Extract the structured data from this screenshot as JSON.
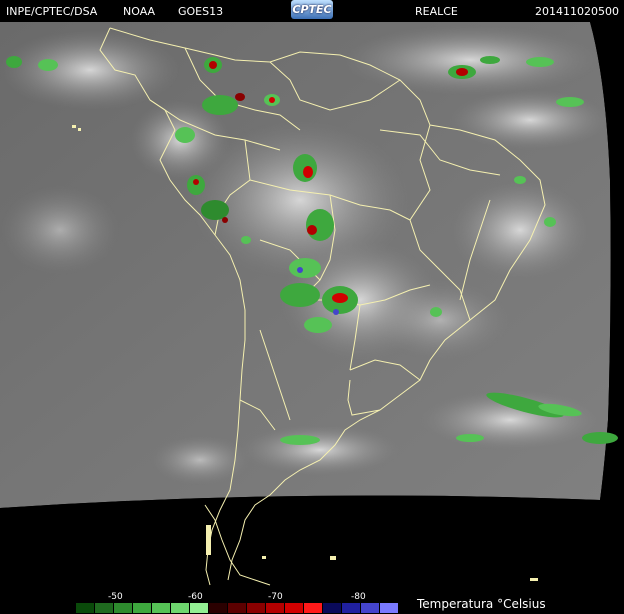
{
  "header": {
    "agency": "INPE/CPTEC/DSA",
    "source": "NOAA",
    "satellite": "GOES13",
    "logo": "CPTEC",
    "product": "REALCE",
    "timestamp": "201411020500"
  },
  "legend": {
    "title": "Temperatura  °Celsius",
    "ticks": [
      "-50",
      "-60",
      "-70",
      "-80"
    ],
    "colors": [
      "#0a4a0a",
      "#1f6a1f",
      "#2e8b2e",
      "#3ea83e",
      "#56c256",
      "#6fd66f",
      "#93ef93",
      "#2a0000",
      "#5c0000",
      "#8a0000",
      "#b30000",
      "#d10000",
      "#ff1a1a",
      "#0a0a5a",
      "#2020a0",
      "#4444cc",
      "#7a7aff"
    ]
  },
  "map": {
    "coastline_color": "#f5f0b0",
    "space_color": "#000000"
  }
}
